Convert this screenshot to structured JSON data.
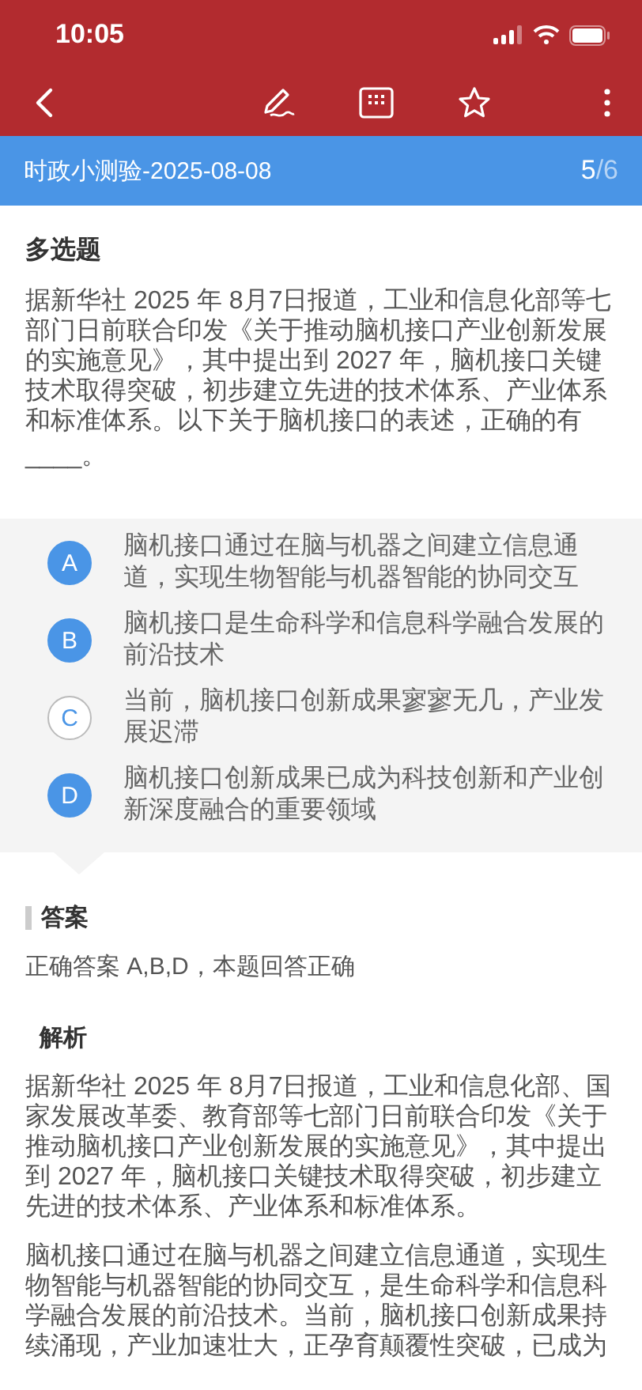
{
  "status_bar": {
    "time": "10:05"
  },
  "quiz": {
    "title": "时政小测验-2025-08-08",
    "current": "5",
    "total": "/6"
  },
  "question": {
    "type": "多选题",
    "text": "据新华社 2025 年 8月7日报道，工业和信息化部等七部门日前联合印发《关于推动脑机接口产业创新发展的实施意见》，其中提出到 2027 年，脑机接口关键技术取得突破，初步建立先进的技术体系、产业体系和标准体系。以下关于脑机接口的表述，正确的有",
    "blank": "____。",
    "options": [
      {
        "letter": "A",
        "text": "脑机接口通过在脑与机器之间建立信息通道，实现生物智能与机器智能的协同交互",
        "selected": true
      },
      {
        "letter": "B",
        "text": "脑机接口是生命科学和信息科学融合发展的前沿技术",
        "selected": true
      },
      {
        "letter": "C",
        "text": "当前，脑机接口创新成果寥寥无几，产业发展迟滞",
        "selected": false
      },
      {
        "letter": "D",
        "text": "脑机接口创新成果已成为科技创新和产业创新深度融合的重要领域",
        "selected": true
      }
    ]
  },
  "answer": {
    "heading": "答案",
    "text": "正确答案 A,B,D，本题回答正确"
  },
  "analysis": {
    "heading": "解析",
    "paragraphs": [
      "据新华社 2025 年 8月7日报道，工业和信息化部、国家发展改革委、教育部等七部门日前联合印发《关于推动脑机接口产业创新发展的实施意见》，其中提出到 2027 年，脑机接口关键技术取得突破，初步建立先进的技术体系、产业体系和标准体系。",
      "脑机接口通过在脑与机器之间建立信息通道，实现生物智能与机器智能的协同交互，是生命科学和信息科学融合发展的前沿技术。当前，脑机接口创新成果持续涌现，产业加速壮大，正孕育颠覆性突破，已成为"
    ]
  }
}
